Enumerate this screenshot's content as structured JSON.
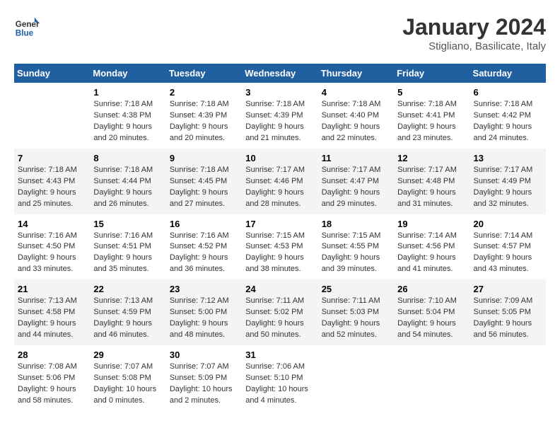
{
  "header": {
    "logo_text_general": "General",
    "logo_text_blue": "Blue",
    "title": "January 2024",
    "subtitle": "Stigliano, Basilicate, Italy"
  },
  "calendar": {
    "days_of_week": [
      "Sunday",
      "Monday",
      "Tuesday",
      "Wednesday",
      "Thursday",
      "Friday",
      "Saturday"
    ],
    "weeks": [
      [
        {
          "day": "",
          "sunrise": "",
          "sunset": "",
          "daylight": ""
        },
        {
          "day": "1",
          "sunrise": "Sunrise: 7:18 AM",
          "sunset": "Sunset: 4:38 PM",
          "daylight": "Daylight: 9 hours and 20 minutes."
        },
        {
          "day": "2",
          "sunrise": "Sunrise: 7:18 AM",
          "sunset": "Sunset: 4:39 PM",
          "daylight": "Daylight: 9 hours and 20 minutes."
        },
        {
          "day": "3",
          "sunrise": "Sunrise: 7:18 AM",
          "sunset": "Sunset: 4:39 PM",
          "daylight": "Daylight: 9 hours and 21 minutes."
        },
        {
          "day": "4",
          "sunrise": "Sunrise: 7:18 AM",
          "sunset": "Sunset: 4:40 PM",
          "daylight": "Daylight: 9 hours and 22 minutes."
        },
        {
          "day": "5",
          "sunrise": "Sunrise: 7:18 AM",
          "sunset": "Sunset: 4:41 PM",
          "daylight": "Daylight: 9 hours and 23 minutes."
        },
        {
          "day": "6",
          "sunrise": "Sunrise: 7:18 AM",
          "sunset": "Sunset: 4:42 PM",
          "daylight": "Daylight: 9 hours and 24 minutes."
        }
      ],
      [
        {
          "day": "7",
          "sunrise": "Sunrise: 7:18 AM",
          "sunset": "Sunset: 4:43 PM",
          "daylight": "Daylight: 9 hours and 25 minutes."
        },
        {
          "day": "8",
          "sunrise": "Sunrise: 7:18 AM",
          "sunset": "Sunset: 4:44 PM",
          "daylight": "Daylight: 9 hours and 26 minutes."
        },
        {
          "day": "9",
          "sunrise": "Sunrise: 7:18 AM",
          "sunset": "Sunset: 4:45 PM",
          "daylight": "Daylight: 9 hours and 27 minutes."
        },
        {
          "day": "10",
          "sunrise": "Sunrise: 7:17 AM",
          "sunset": "Sunset: 4:46 PM",
          "daylight": "Daylight: 9 hours and 28 minutes."
        },
        {
          "day": "11",
          "sunrise": "Sunrise: 7:17 AM",
          "sunset": "Sunset: 4:47 PM",
          "daylight": "Daylight: 9 hours and 29 minutes."
        },
        {
          "day": "12",
          "sunrise": "Sunrise: 7:17 AM",
          "sunset": "Sunset: 4:48 PM",
          "daylight": "Daylight: 9 hours and 31 minutes."
        },
        {
          "day": "13",
          "sunrise": "Sunrise: 7:17 AM",
          "sunset": "Sunset: 4:49 PM",
          "daylight": "Daylight: 9 hours and 32 minutes."
        }
      ],
      [
        {
          "day": "14",
          "sunrise": "Sunrise: 7:16 AM",
          "sunset": "Sunset: 4:50 PM",
          "daylight": "Daylight: 9 hours and 33 minutes."
        },
        {
          "day": "15",
          "sunrise": "Sunrise: 7:16 AM",
          "sunset": "Sunset: 4:51 PM",
          "daylight": "Daylight: 9 hours and 35 minutes."
        },
        {
          "day": "16",
          "sunrise": "Sunrise: 7:16 AM",
          "sunset": "Sunset: 4:52 PM",
          "daylight": "Daylight: 9 hours and 36 minutes."
        },
        {
          "day": "17",
          "sunrise": "Sunrise: 7:15 AM",
          "sunset": "Sunset: 4:53 PM",
          "daylight": "Daylight: 9 hours and 38 minutes."
        },
        {
          "day": "18",
          "sunrise": "Sunrise: 7:15 AM",
          "sunset": "Sunset: 4:55 PM",
          "daylight": "Daylight: 9 hours and 39 minutes."
        },
        {
          "day": "19",
          "sunrise": "Sunrise: 7:14 AM",
          "sunset": "Sunset: 4:56 PM",
          "daylight": "Daylight: 9 hours and 41 minutes."
        },
        {
          "day": "20",
          "sunrise": "Sunrise: 7:14 AM",
          "sunset": "Sunset: 4:57 PM",
          "daylight": "Daylight: 9 hours and 43 minutes."
        }
      ],
      [
        {
          "day": "21",
          "sunrise": "Sunrise: 7:13 AM",
          "sunset": "Sunset: 4:58 PM",
          "daylight": "Daylight: 9 hours and 44 minutes."
        },
        {
          "day": "22",
          "sunrise": "Sunrise: 7:13 AM",
          "sunset": "Sunset: 4:59 PM",
          "daylight": "Daylight: 9 hours and 46 minutes."
        },
        {
          "day": "23",
          "sunrise": "Sunrise: 7:12 AM",
          "sunset": "Sunset: 5:00 PM",
          "daylight": "Daylight: 9 hours and 48 minutes."
        },
        {
          "day": "24",
          "sunrise": "Sunrise: 7:11 AM",
          "sunset": "Sunset: 5:02 PM",
          "daylight": "Daylight: 9 hours and 50 minutes."
        },
        {
          "day": "25",
          "sunrise": "Sunrise: 7:11 AM",
          "sunset": "Sunset: 5:03 PM",
          "daylight": "Daylight: 9 hours and 52 minutes."
        },
        {
          "day": "26",
          "sunrise": "Sunrise: 7:10 AM",
          "sunset": "Sunset: 5:04 PM",
          "daylight": "Daylight: 9 hours and 54 minutes."
        },
        {
          "day": "27",
          "sunrise": "Sunrise: 7:09 AM",
          "sunset": "Sunset: 5:05 PM",
          "daylight": "Daylight: 9 hours and 56 minutes."
        }
      ],
      [
        {
          "day": "28",
          "sunrise": "Sunrise: 7:08 AM",
          "sunset": "Sunset: 5:06 PM",
          "daylight": "Daylight: 9 hours and 58 minutes."
        },
        {
          "day": "29",
          "sunrise": "Sunrise: 7:07 AM",
          "sunset": "Sunset: 5:08 PM",
          "daylight": "Daylight: 10 hours and 0 minutes."
        },
        {
          "day": "30",
          "sunrise": "Sunrise: 7:07 AM",
          "sunset": "Sunset: 5:09 PM",
          "daylight": "Daylight: 10 hours and 2 minutes."
        },
        {
          "day": "31",
          "sunrise": "Sunrise: 7:06 AM",
          "sunset": "Sunset: 5:10 PM",
          "daylight": "Daylight: 10 hours and 4 minutes."
        },
        {
          "day": "",
          "sunrise": "",
          "sunset": "",
          "daylight": ""
        },
        {
          "day": "",
          "sunrise": "",
          "sunset": "",
          "daylight": ""
        },
        {
          "day": "",
          "sunrise": "",
          "sunset": "",
          "daylight": ""
        }
      ]
    ]
  }
}
